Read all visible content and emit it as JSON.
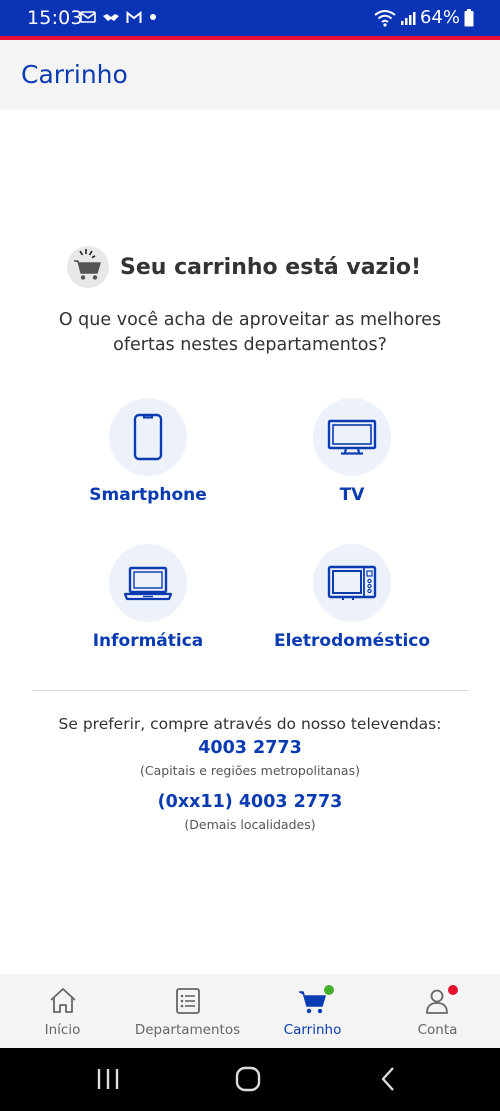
{
  "status_bar": {
    "time": "15:03",
    "battery": "64%",
    "icons": [
      "outlook-icon",
      "handshake-icon",
      "gmail-icon",
      "dot-icon",
      "wifi-icon",
      "signal-icon",
      "battery-icon"
    ]
  },
  "app_bar": {
    "title": "Carrinho"
  },
  "empty_cart": {
    "title": "Seu carrinho está vazio!",
    "subtitle_line1": "O que você acha de aproveitar as melhores",
    "subtitle_line2": "ofertas nestes departamentos?"
  },
  "departments": [
    {
      "label": "Smartphone",
      "icon": "smartphone-icon"
    },
    {
      "label": "TV",
      "icon": "tv-icon"
    },
    {
      "label": "Informática",
      "icon": "laptop-icon"
    },
    {
      "label": "Eletrodoméstico",
      "icon": "microwave-icon"
    }
  ],
  "televendas": {
    "intro": "Se preferir, compre através do nosso televendas:",
    "phone1": "4003 2773",
    "note1": "(Capitais e regiões metropolitanas)",
    "phone2": "(0xx11) 4003 2773",
    "note2": "(Demais localidades)"
  },
  "bottom_nav": {
    "items": [
      {
        "label": "Início",
        "icon": "home-icon",
        "active": false
      },
      {
        "label": "Departamentos",
        "icon": "list-icon",
        "active": false
      },
      {
        "label": "Carrinho",
        "icon": "cart-icon",
        "active": true
      },
      {
        "label": "Conta",
        "icon": "user-icon",
        "active": false
      }
    ]
  },
  "colors": {
    "brand_blue": "#0a3bb0",
    "status_blue": "#0a33b5",
    "accent_red": "#e8103a",
    "badge_green": "#43b02a",
    "badge_red": "#e3122c"
  }
}
